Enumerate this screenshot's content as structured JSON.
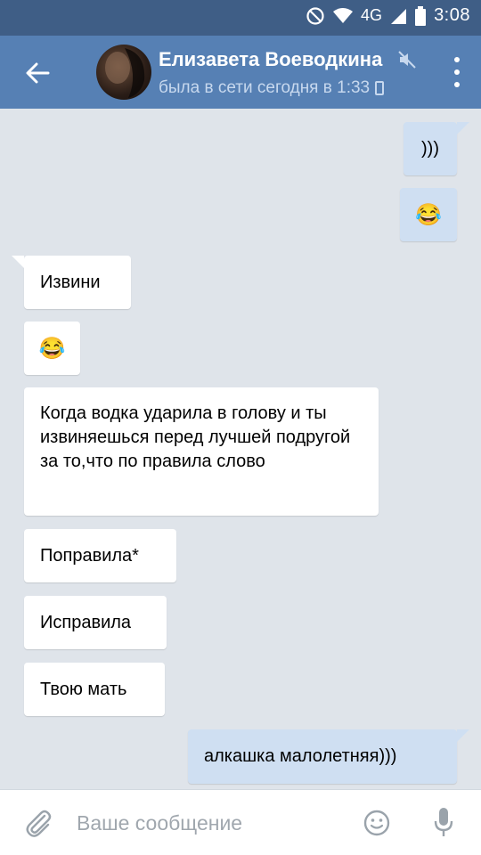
{
  "status_bar": {
    "time": "3:08",
    "network": "4G",
    "icons": [
      "no-disturb-icon",
      "wifi-icon",
      "signal-icon",
      "battery-icon"
    ]
  },
  "header": {
    "name": "Елизавета Воеводкина",
    "last_seen": "была в сети сегодня в 1:33",
    "icons": [
      "back-arrow-icon",
      "avatar",
      "mute-icon",
      "phone-icon",
      "more-vertical-icon"
    ]
  },
  "messages": [
    {
      "dir": "out",
      "text": ")))"
    },
    {
      "dir": "out",
      "text": "😂"
    },
    {
      "dir": "in",
      "text": "Извини"
    },
    {
      "dir": "in",
      "text": "😂"
    },
    {
      "dir": "in",
      "text": "Когда водка ударила в голову и ты извиняешься перед лучшей подругой за то,что по правила слово"
    },
    {
      "dir": "in",
      "text": "Поправила*"
    },
    {
      "dir": "in",
      "text": "Исправила"
    },
    {
      "dir": "in",
      "text": "Твою мать"
    },
    {
      "dir": "out",
      "text": "алкашка малолетняя)))"
    }
  ],
  "composer": {
    "placeholder": "Ваше сообщение",
    "value": "",
    "icons": [
      "attach-icon",
      "smile-icon",
      "mic-icon"
    ]
  },
  "colors": {
    "header": "#5680b4",
    "status_bar": "#3f5e86",
    "background": "#dfe4ea",
    "incoming": "#ffffff",
    "outgoing": "#cfdff2"
  }
}
